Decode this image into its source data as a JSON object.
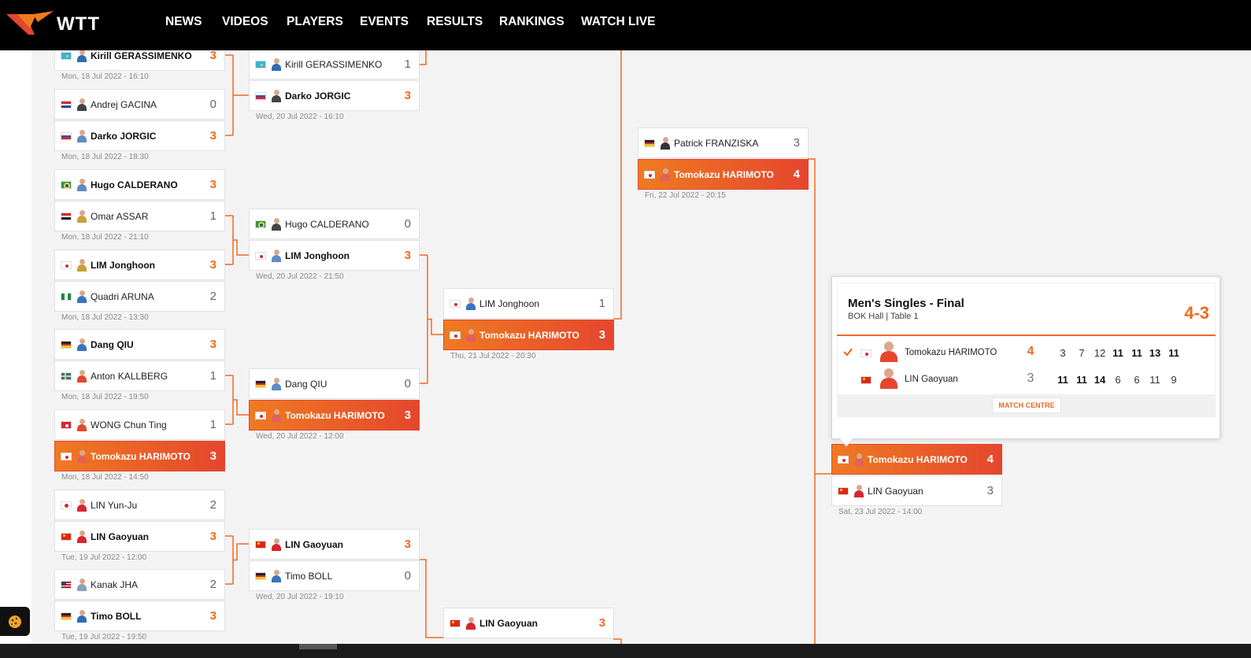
{
  "brand": {
    "logo_text": "WTT",
    "accent": "#ef6a22",
    "highlight_gradient": [
      "#ef7a22",
      "#e5462e"
    ]
  },
  "nav": [
    {
      "label": "NEWS"
    },
    {
      "label": "VIDEOS"
    },
    {
      "label": "PLAYERS"
    },
    {
      "label": "EVENTS"
    },
    {
      "label": "RESULTS"
    },
    {
      "label": "RANKINGS"
    },
    {
      "label": "WATCH LIVE"
    }
  ],
  "matches": [
    {
      "id": "r1m1",
      "date": "Mon, 18 Jul 2022 - 16:10",
      "players": [
        {
          "name": "Kirill GERASSIMENKO",
          "flag": "kz",
          "score": "3",
          "win": true
        }
      ]
    },
    {
      "id": "r1m2",
      "date": "Mon, 18 Jul 2022 - 18:30",
      "players": [
        {
          "name": "Andrej GACINA",
          "flag": "hr",
          "score": "0",
          "win": false
        },
        {
          "name": "Darko JORGIC",
          "flag": "si",
          "score": "3",
          "win": true
        }
      ]
    },
    {
      "id": "r1m3",
      "date": "Mon, 18 Jul 2022 - 21:10",
      "players": [
        {
          "name": "Hugo CALDERANO",
          "flag": "br",
          "score": "3",
          "win": true
        },
        {
          "name": "Omar ASSAR",
          "flag": "eg",
          "score": "1",
          "win": false
        }
      ]
    },
    {
      "id": "r1m4",
      "date": "Mon, 18 Jul 2022 - 13:30",
      "players": [
        {
          "name": "LIM Jonghoon",
          "flag": "kr",
          "score": "3",
          "win": true
        },
        {
          "name": "Quadri ARUNA",
          "flag": "ng",
          "score": "2",
          "win": false
        }
      ]
    },
    {
      "id": "r1m5",
      "date": "Mon, 18 Jul 2022 - 19:50",
      "players": [
        {
          "name": "Dang QIU",
          "flag": "de",
          "score": "3",
          "win": true
        },
        {
          "name": "Anton KALLBERG",
          "flag": "se",
          "score": "1",
          "win": false
        }
      ]
    },
    {
      "id": "r1m6",
      "date": "Mon, 18 Jul 2022 - 14:50",
      "players": [
        {
          "name": "WONG Chun Ting",
          "flag": "hk",
          "score": "1",
          "win": false
        },
        {
          "name": "Tomokazu HARIMOTO",
          "flag": "jp",
          "score": "3",
          "win": true,
          "highlight": true
        }
      ]
    },
    {
      "id": "r1m7",
      "date": "Tue, 19 Jul 2022 - 12:00",
      "players": [
        {
          "name": "LIN Yun-Ju",
          "flag": "tw",
          "score": "2",
          "win": false
        },
        {
          "name": "LIN Gaoyuan",
          "flag": "cn",
          "score": "3",
          "win": true
        }
      ]
    },
    {
      "id": "r1m8",
      "date": "Tue, 19 Jul 2022 - 19:50",
      "players": [
        {
          "name": "Kanak JHA",
          "flag": "us",
          "score": "2",
          "win": false
        },
        {
          "name": "Timo BOLL",
          "flag": "de",
          "score": "3",
          "win": true
        }
      ]
    },
    {
      "id": "r2m1",
      "date": "Wed, 20 Jul 2022 - 16:10",
      "players": [
        {
          "name": "Kirill GERASSIMENKO",
          "flag": "kz",
          "score": "1",
          "win": false
        },
        {
          "name": "Darko JORGIC",
          "flag": "si",
          "score": "3",
          "win": true
        }
      ]
    },
    {
      "id": "r2m2",
      "date": "Wed, 20 Jul 2022 - 21:50",
      "players": [
        {
          "name": "Hugo CALDERANO",
          "flag": "br",
          "score": "0",
          "win": false
        },
        {
          "name": "LIM Jonghoon",
          "flag": "kr",
          "score": "3",
          "win": true
        }
      ]
    },
    {
      "id": "r2m3",
      "date": "Wed, 20 Jul 2022 - 12:00",
      "players": [
        {
          "name": "Dang QIU",
          "flag": "de",
          "score": "0",
          "win": false
        },
        {
          "name": "Tomokazu HARIMOTO",
          "flag": "jp",
          "score": "3",
          "win": true,
          "highlight": true
        }
      ]
    },
    {
      "id": "r2m4",
      "date": "Wed, 20 Jul 2022 - 19:10",
      "players": [
        {
          "name": "LIN Gaoyuan",
          "flag": "cn",
          "score": "3",
          "win": true
        },
        {
          "name": "Timo BOLL",
          "flag": "de",
          "score": "0",
          "win": false
        }
      ]
    },
    {
      "id": "r3m1",
      "date": "Thu, 21 Jul 2022 - 20:30",
      "players": [
        {
          "name": "LIM Jonghoon",
          "flag": "kr",
          "score": "1",
          "win": false
        },
        {
          "name": "Tomokazu HARIMOTO",
          "flag": "jp",
          "score": "3",
          "win": true,
          "highlight": true
        }
      ]
    },
    {
      "id": "r3m2",
      "date": "",
      "players": [
        {
          "name": "LIN Gaoyuan",
          "flag": "cn",
          "score": "3",
          "win": true
        }
      ]
    },
    {
      "id": "r4m1",
      "date": "Fri, 22 Jul 2022 - 20:15",
      "players": [
        {
          "name": "Patrick FRANZISKA",
          "flag": "de",
          "score": "3",
          "win": false
        },
        {
          "name": "Tomokazu HARIMOTO",
          "flag": "jp",
          "score": "4",
          "win": true,
          "highlight": true
        }
      ]
    },
    {
      "id": "final",
      "date": "Sat, 23 Jul 2022 - 14:00",
      "players": [
        {
          "name": "Tomokazu HARIMOTO",
          "flag": "jp",
          "score": "4",
          "win": true,
          "highlight": true
        },
        {
          "name": "LIN Gaoyuan",
          "flag": "cn",
          "score": "3",
          "win": false
        }
      ]
    }
  ],
  "final_popup": {
    "title": "Men's Singles - Final",
    "venue": "BOK Hall | Table 1",
    "result": "4-3",
    "button": "MATCH CENTRE",
    "players": [
      {
        "name": "Tomokazu HARIMOTO",
        "flag": "jp",
        "score": "4",
        "win": true,
        "games": [
          "3",
          "7",
          "12",
          "11",
          "11",
          "13",
          "11"
        ],
        "game_wins": [
          false,
          false,
          false,
          true,
          true,
          true,
          true
        ]
      },
      {
        "name": "LIN Gaoyuan",
        "flag": "cn",
        "score": "3",
        "win": false,
        "games": [
          "11",
          "11",
          "14",
          "6",
          "6",
          "11",
          "9"
        ],
        "game_wins": [
          true,
          true,
          true,
          false,
          false,
          false,
          false
        ]
      }
    ]
  }
}
